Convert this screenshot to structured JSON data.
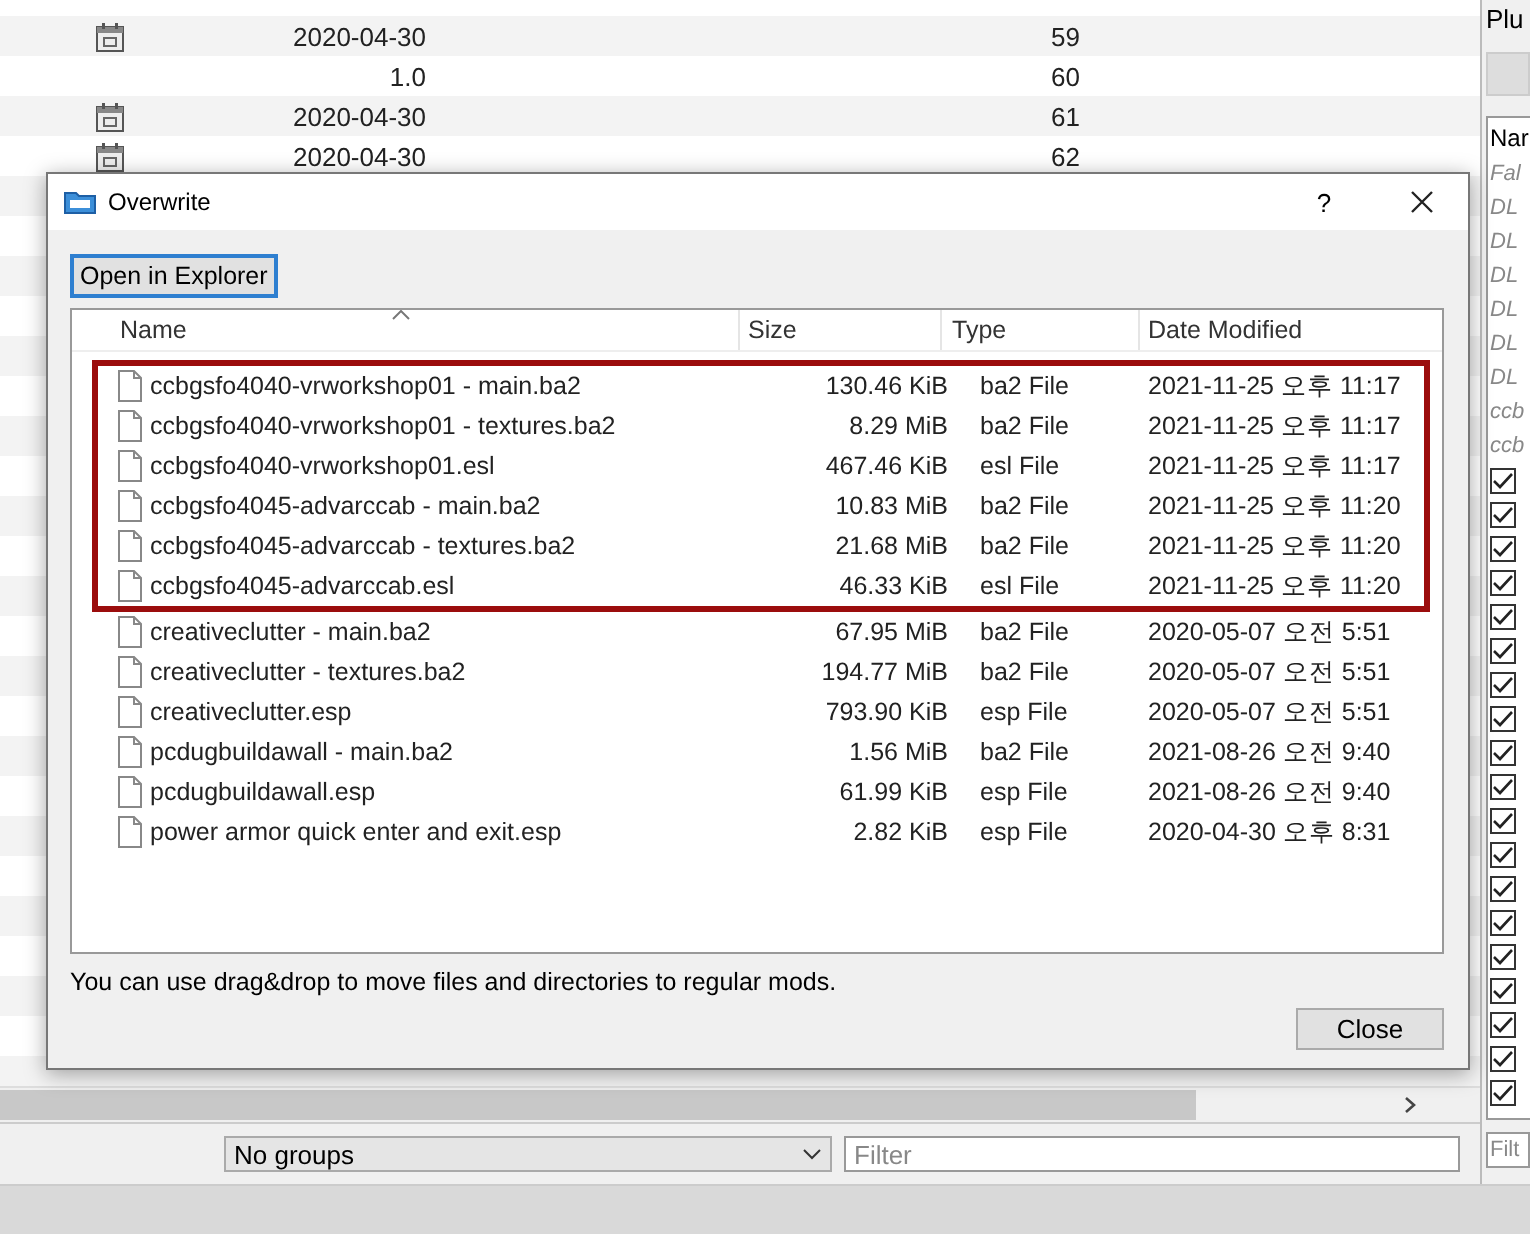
{
  "background_list": {
    "rows": [
      {
        "has_icon": true,
        "version": "2020-04-30",
        "priority": "59"
      },
      {
        "has_icon": false,
        "version": "1.0",
        "priority": "60"
      },
      {
        "has_icon": true,
        "version": "2020-04-30",
        "priority": "61"
      },
      {
        "has_icon": true,
        "version": "2020-04-30",
        "priority": "62"
      }
    ]
  },
  "background_bottom": {
    "group_select": "No groups",
    "filter_placeholder": "Filter"
  },
  "plugins_panel": {
    "title": "Plu",
    "header": "Nar",
    "items": [
      {
        "kind": "label",
        "text": "Fal"
      },
      {
        "kind": "label",
        "text": "DL"
      },
      {
        "kind": "label",
        "text": "DL"
      },
      {
        "kind": "label",
        "text": "DL"
      },
      {
        "kind": "label",
        "text": "DL"
      },
      {
        "kind": "label",
        "text": "DL"
      },
      {
        "kind": "label",
        "text": "DL"
      },
      {
        "kind": "label",
        "text": "ccb"
      },
      {
        "kind": "label",
        "text": "ccb"
      },
      {
        "kind": "checkbox",
        "checked": true
      },
      {
        "kind": "checkbox",
        "checked": true
      },
      {
        "kind": "checkbox",
        "checked": true
      },
      {
        "kind": "checkbox",
        "checked": true
      },
      {
        "kind": "checkbox",
        "checked": true
      },
      {
        "kind": "checkbox",
        "checked": true
      },
      {
        "kind": "checkbox",
        "checked": true
      },
      {
        "kind": "checkbox",
        "checked": true
      },
      {
        "kind": "checkbox",
        "checked": true
      },
      {
        "kind": "checkbox",
        "checked": true
      },
      {
        "kind": "checkbox",
        "checked": true
      },
      {
        "kind": "checkbox",
        "checked": true
      },
      {
        "kind": "checkbox",
        "checked": true
      },
      {
        "kind": "checkbox",
        "checked": true
      },
      {
        "kind": "checkbox",
        "checked": true
      },
      {
        "kind": "checkbox",
        "checked": true
      },
      {
        "kind": "checkbox",
        "checked": true
      },
      {
        "kind": "checkbox",
        "checked": true
      },
      {
        "kind": "checkbox",
        "checked": true
      }
    ],
    "filter_placeholder": "Filt"
  },
  "dialog": {
    "title": "Overwrite",
    "help": "?",
    "open_button": "Open in Explorer",
    "columns": [
      "Name",
      "Size",
      "Type",
      "Date Modified"
    ],
    "files": [
      {
        "name": "ccbgsfo4040-vrworkshop01 - main.ba2",
        "size": "130.46 KiB",
        "type": "ba2 File",
        "modified": "2021-11-25 오후 11:17",
        "highlighted": true
      },
      {
        "name": "ccbgsfo4040-vrworkshop01 - textures.ba2",
        "size": "8.29 MiB",
        "type": "ba2 File",
        "modified": "2021-11-25 오후 11:17",
        "highlighted": true
      },
      {
        "name": "ccbgsfo4040-vrworkshop01.esl",
        "size": "467.46 KiB",
        "type": "esl File",
        "modified": "2021-11-25 오후 11:17",
        "highlighted": true
      },
      {
        "name": "ccbgsfo4045-advarccab - main.ba2",
        "size": "10.83 MiB",
        "type": "ba2 File",
        "modified": "2021-11-25 오후 11:20",
        "highlighted": true
      },
      {
        "name": "ccbgsfo4045-advarccab - textures.ba2",
        "size": "21.68 MiB",
        "type": "ba2 File",
        "modified": "2021-11-25 오후 11:20",
        "highlighted": true
      },
      {
        "name": "ccbgsfo4045-advarccab.esl",
        "size": "46.33 KiB",
        "type": "esl File",
        "modified": "2021-11-25 오후 11:20",
        "highlighted": true
      },
      {
        "name": "creativeclutter - main.ba2",
        "size": "67.95 MiB",
        "type": "ba2 File",
        "modified": "2020-05-07 오전 5:51",
        "highlighted": false
      },
      {
        "name": "creativeclutter - textures.ba2",
        "size": "194.77 MiB",
        "type": "ba2 File",
        "modified": "2020-05-07 오전 5:51",
        "highlighted": false
      },
      {
        "name": "creativeclutter.esp",
        "size": "793.90 KiB",
        "type": "esp File",
        "modified": "2020-05-07 오전 5:51",
        "highlighted": false
      },
      {
        "name": "pcdugbuildawall - main.ba2",
        "size": "1.56 MiB",
        "type": "ba2 File",
        "modified": "2021-08-26 오전 9:40",
        "highlighted": false
      },
      {
        "name": "pcdugbuildawall.esp",
        "size": "61.99 KiB",
        "type": "esp File",
        "modified": "2021-08-26 오전 9:40",
        "highlighted": false
      },
      {
        "name": "power armor quick enter and exit.esp",
        "size": "2.82 KiB",
        "type": "esp File",
        "modified": "2020-04-30 오후 8:31",
        "highlighted": false
      }
    ],
    "hint": "You can use drag&drop to move files and directories to regular mods.",
    "close_button": "Close"
  }
}
